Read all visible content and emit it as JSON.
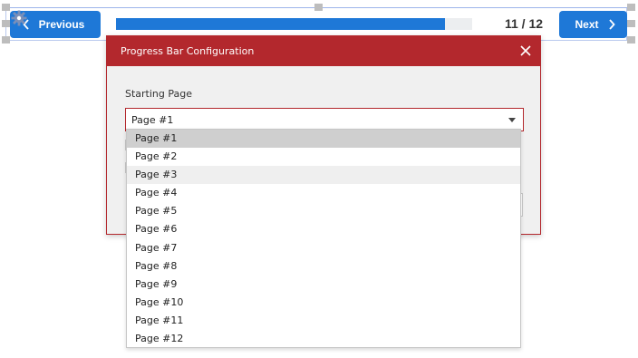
{
  "navigation": {
    "previous_label": "Previous",
    "next_label": "Next",
    "page_counter": "11 / 12",
    "progress_fraction": 0.924
  },
  "dialog": {
    "title": "Progress Bar Configuration",
    "field_label": "Starting Page",
    "selected_value": "Page #1"
  },
  "dropdown": {
    "options": [
      "Page #1",
      "Page #2",
      "Page #3",
      "Page #4",
      "Page #5",
      "Page #6",
      "Page #7",
      "Page #8",
      "Page #9",
      "Page #10",
      "Page #11",
      "Page #12"
    ],
    "selected_index": 0,
    "hover_index": 2
  },
  "colors": {
    "accent_blue": "#1e78d7",
    "dialog_red": "#b3282d"
  },
  "icons": [
    "gear-icon",
    "chevron-left-icon",
    "chevron-right-icon",
    "close-icon",
    "caret-down-icon"
  ]
}
